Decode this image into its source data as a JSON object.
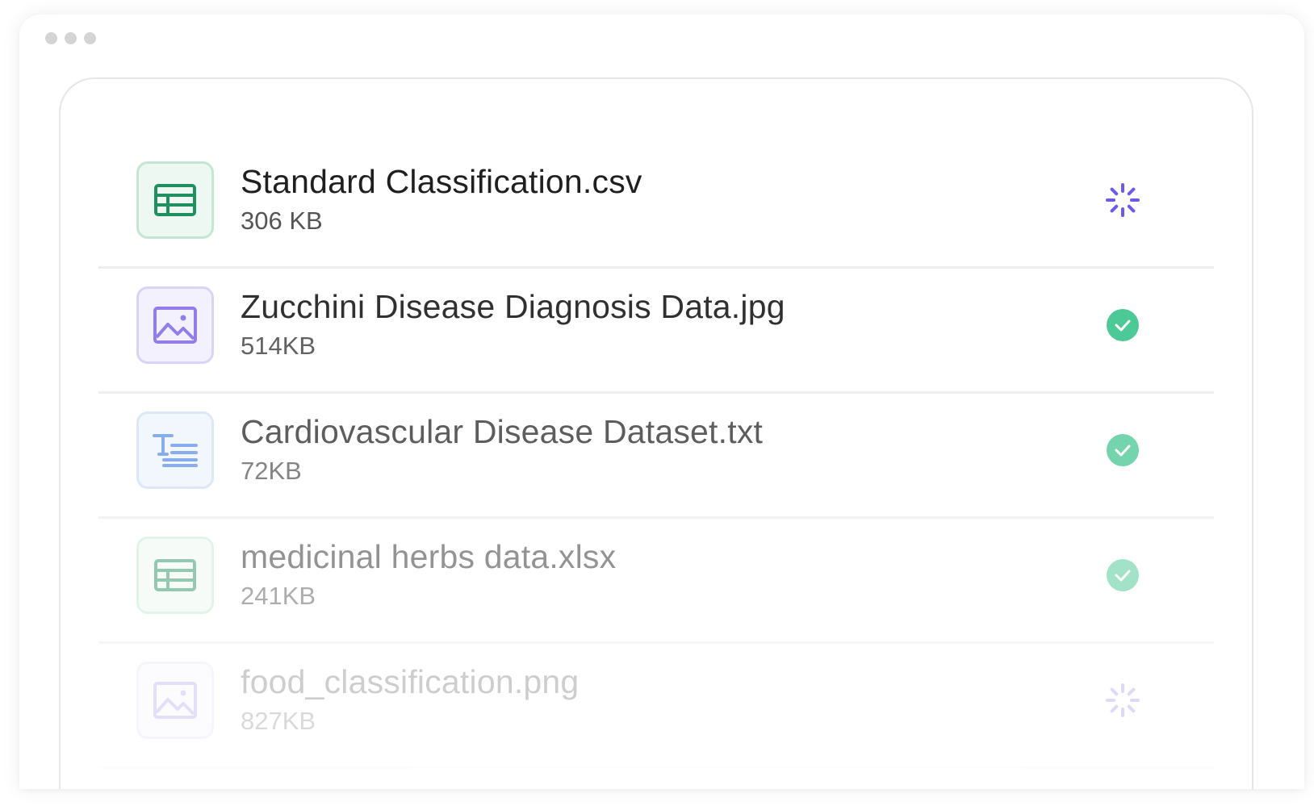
{
  "window": {
    "controls": [
      "dot",
      "dot",
      "dot"
    ]
  },
  "files": [
    {
      "name": "Standard Classification.csv",
      "size": "306 KB",
      "type": "spreadsheet-icon",
      "status": "loading"
    },
    {
      "name": "Zucchini Disease Diagnosis Data.jpg",
      "size": "514KB",
      "type": "image-icon",
      "status": "complete"
    },
    {
      "name": "Cardiovascular Disease Dataset.txt",
      "size": "72KB",
      "type": "text-file-icon",
      "status": "complete"
    },
    {
      "name": "medicinal herbs data.xlsx",
      "size": "241KB",
      "type": "spreadsheet-icon",
      "status": "complete"
    },
    {
      "name": "food_classification.png",
      "size": "827KB",
      "type": "image-icon",
      "status": "loading"
    }
  ],
  "colors": {
    "spreadsheet": "#1f8f5f",
    "image": "#8a73e8",
    "text": "#5b8de6",
    "spinner": "#6a5ce8",
    "success": "#3ec48f"
  }
}
